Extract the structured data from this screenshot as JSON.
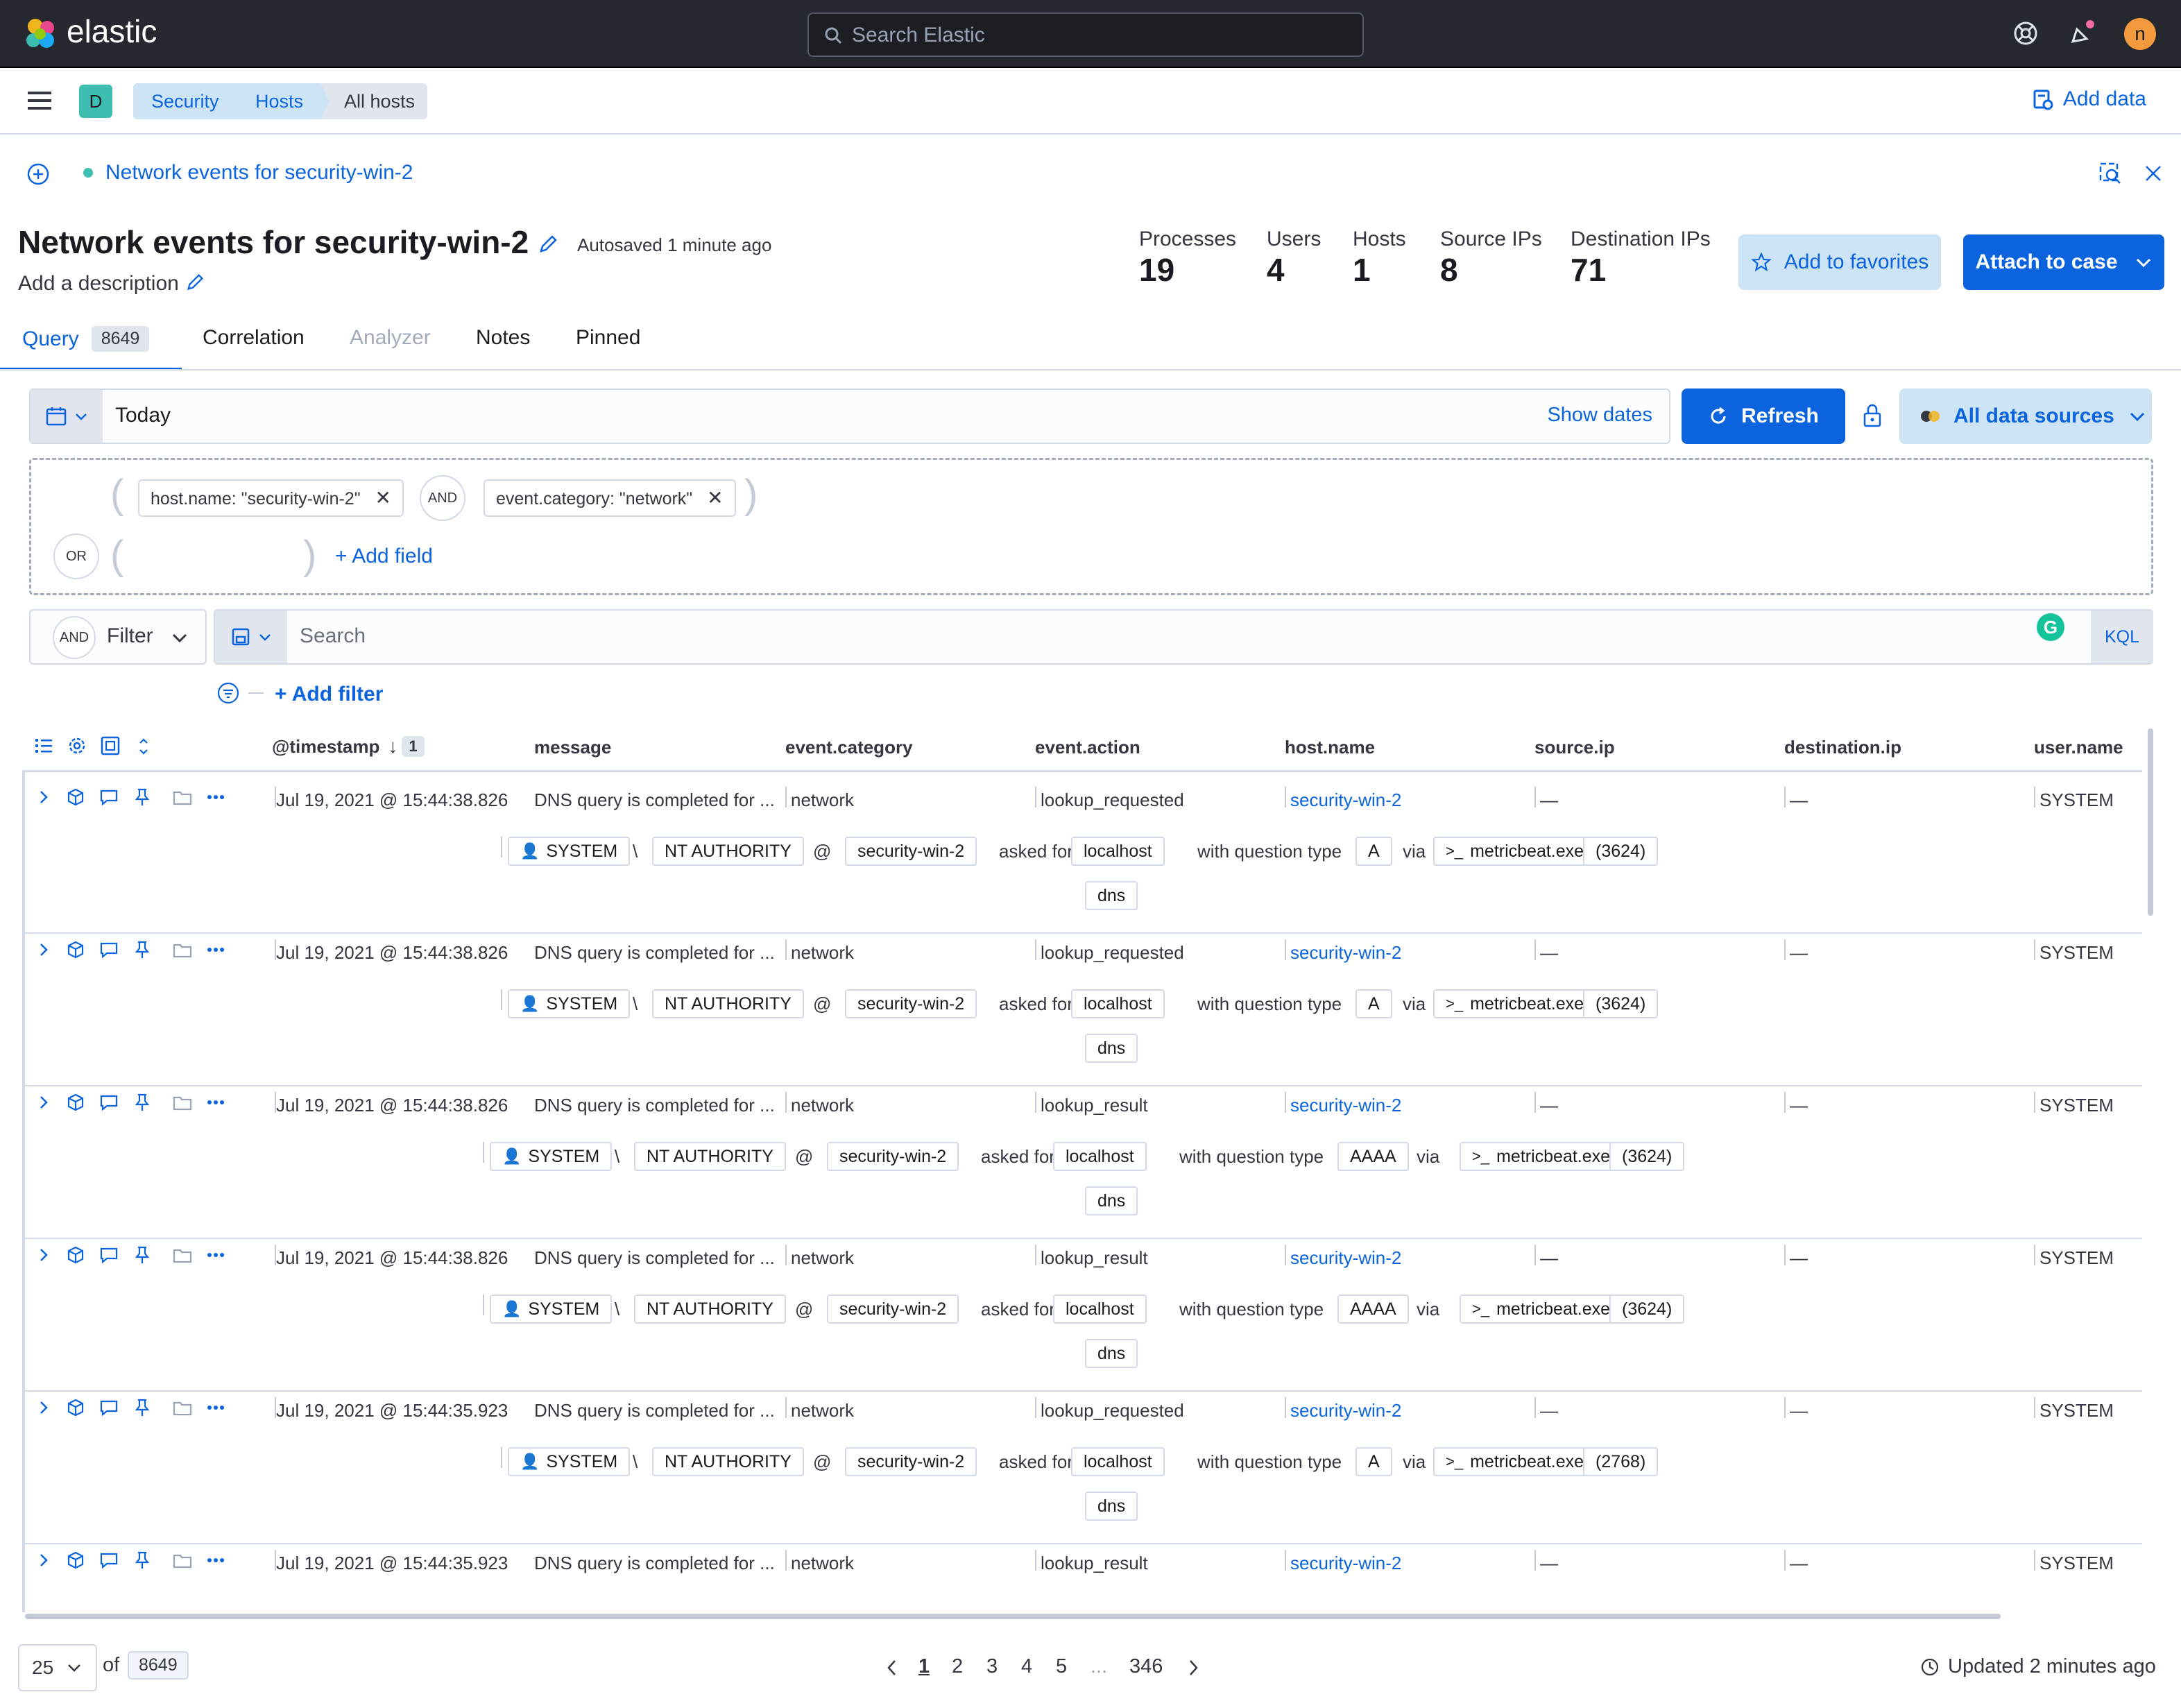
{
  "header": {
    "brand": "elastic",
    "search_placeholder": "Search Elastic",
    "avatar_initial": "n"
  },
  "nav": {
    "space_initial": "D",
    "breadcrumbs": [
      "Security",
      "Hosts",
      "All hosts"
    ],
    "add_data": "Add data"
  },
  "timeline": {
    "tab_title": "Network events for security-win-2",
    "title": "Network events for security-win-2",
    "autosave": "Autosaved 1 minute ago",
    "description": "Add a description",
    "stats": [
      {
        "label": "Processes",
        "value": "19"
      },
      {
        "label": "Users",
        "value": "4"
      },
      {
        "label": "Hosts",
        "value": "1"
      },
      {
        "label": "Source IPs",
        "value": "8"
      },
      {
        "label": "Destination IPs",
        "value": "71"
      }
    ],
    "add_favorites": "Add to favorites",
    "attach_case": "Attach to case",
    "tabs": [
      "Query",
      "Correlation",
      "Analyzer",
      "Notes",
      "Pinned"
    ],
    "query_count": "8649"
  },
  "query": {
    "date_value": "Today",
    "show_dates": "Show dates",
    "refresh": "Refresh",
    "data_sources": "All data sources",
    "and_label": "AND",
    "or_label": "OR",
    "filter_pill_1": "host.name: \"security-win-2\"",
    "filter_pill_2": "event.category: \"network\"",
    "add_field": "+ Add field",
    "filter_label": "Filter",
    "search_placeholder": "Search",
    "kql": "KQL",
    "add_filter": "+ Add filter"
  },
  "table": {
    "sort_count": "1",
    "columns": [
      "@timestamp",
      "message",
      "event.category",
      "event.action",
      "host.name",
      "source.ip",
      "destination.ip",
      "user.name"
    ],
    "rows": [
      {
        "timestamp": "Jul 19, 2021 @ 15:44:38.826",
        "message": "DNS query is completed for ...",
        "category": "network",
        "action": "lookup_requested",
        "host": "security-win-2",
        "source_ip": "—",
        "dest_ip": "—",
        "user": "SYSTEM",
        "qtype": "A",
        "pid": "(3624)"
      },
      {
        "timestamp": "Jul 19, 2021 @ 15:44:38.826",
        "message": "DNS query is completed for ...",
        "category": "network",
        "action": "lookup_requested",
        "host": "security-win-2",
        "source_ip": "—",
        "dest_ip": "—",
        "user": "SYSTEM",
        "qtype": "A",
        "pid": "(3624)"
      },
      {
        "timestamp": "Jul 19, 2021 @ 15:44:38.826",
        "message": "DNS query is completed for ...",
        "category": "network",
        "action": "lookup_result",
        "host": "security-win-2",
        "source_ip": "—",
        "dest_ip": "—",
        "user": "SYSTEM",
        "qtype": "AAAA",
        "pid": "(3624)"
      },
      {
        "timestamp": "Jul 19, 2021 @ 15:44:38.826",
        "message": "DNS query is completed for ...",
        "category": "network",
        "action": "lookup_result",
        "host": "security-win-2",
        "source_ip": "—",
        "dest_ip": "—",
        "user": "SYSTEM",
        "qtype": "AAAA",
        "pid": "(3624)"
      },
      {
        "timestamp": "Jul 19, 2021 @ 15:44:35.923",
        "message": "DNS query is completed for ...",
        "category": "network",
        "action": "lookup_requested",
        "host": "security-win-2",
        "source_ip": "—",
        "dest_ip": "—",
        "user": "SYSTEM",
        "qtype": "A",
        "pid": "(2768)"
      },
      {
        "timestamp": "Jul 19, 2021 @ 15:44:35.923",
        "message": "DNS query is completed for ...",
        "category": "network",
        "action": "lookup_result",
        "host": "security-win-2",
        "source_ip": "—",
        "dest_ip": "—",
        "user": "SYSTEM"
      }
    ],
    "detail": {
      "user": "SYSTEM",
      "sep": "\\",
      "domain": "NT AUTHORITY",
      "at": "@",
      "host": "security-win-2",
      "asked_for": "asked for",
      "query": "localhost",
      "with_qtype": "with question type",
      "via": "via",
      "process": "metricbeat.exe",
      "protocol": "dns"
    }
  },
  "footer": {
    "page_size": "25",
    "of": "of",
    "total": "8649",
    "pages": [
      "1",
      "2",
      "3",
      "4",
      "5",
      "...",
      "346"
    ],
    "updated": "Updated 2 minutes ago"
  }
}
